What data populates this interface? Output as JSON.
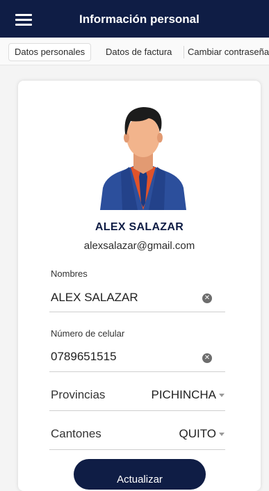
{
  "header": {
    "title": "Información personal",
    "menu_icon": "hamburger-menu-icon"
  },
  "tabs": [
    {
      "label": "Datos personales",
      "active": true
    },
    {
      "label": "Datos de factura",
      "active": false
    },
    {
      "label": "Cambiar contraseña",
      "active": false
    }
  ],
  "profile": {
    "avatar_icon": "businessman-avatar",
    "name": "ALEX SALAZAR",
    "email": "alexsalazar@gmail.com"
  },
  "form": {
    "nombres": {
      "label": "Nombres",
      "value": "ALEX SALAZAR"
    },
    "celular": {
      "label": "Número de celular",
      "value": "0789651515"
    },
    "provincias": {
      "label": "Provincias",
      "value": "PICHINCHA"
    },
    "cantones": {
      "label": "Cantones",
      "value": "QUITO"
    }
  },
  "actions": {
    "update_label": "Actualizar"
  },
  "colors": {
    "primary": "#0f1d45",
    "avatar_suit": "#2c4f9c",
    "avatar_shirt": "#e0532a",
    "avatar_skin": "#f2b48c",
    "avatar_hair": "#1c1c1c"
  }
}
